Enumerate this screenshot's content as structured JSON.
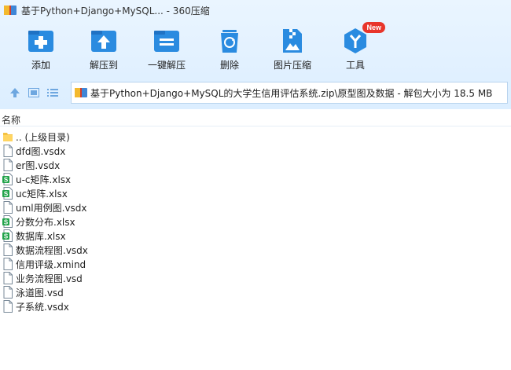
{
  "window": {
    "title": "基于Python+Django+MySQL... - 360压缩"
  },
  "toolbar": {
    "items": [
      {
        "label": "添加",
        "icon": "add-icon"
      },
      {
        "label": "解压到",
        "icon": "extract-to-icon"
      },
      {
        "label": "一键解压",
        "icon": "one-click-extract-icon"
      },
      {
        "label": "删除",
        "icon": "delete-icon"
      },
      {
        "label": "图片压缩",
        "icon": "image-compress-icon"
      },
      {
        "label": "工具",
        "icon": "tools-icon",
        "badge": "New"
      }
    ]
  },
  "address": {
    "path": "基于Python+Django+MySQL的大学生信用评估系统.zip\\原型图及数据 - 解包大小为 18.5 MB"
  },
  "list": {
    "column_name": "名称",
    "files": [
      {
        "name": ".. (上级目录)",
        "type": "folder"
      },
      {
        "name": "dfd图.vsdx",
        "type": "doc"
      },
      {
        "name": "er图.vsdx",
        "type": "doc"
      },
      {
        "name": "u-c矩阵.xlsx",
        "type": "sheet"
      },
      {
        "name": "uc矩阵.xlsx",
        "type": "sheet"
      },
      {
        "name": "uml用例图.vsdx",
        "type": "doc"
      },
      {
        "name": "分数分布.xlsx",
        "type": "sheet"
      },
      {
        "name": "数据库.xlsx",
        "type": "sheet"
      },
      {
        "name": "数据流程图.vsdx",
        "type": "doc"
      },
      {
        "name": "信用评级.xmind",
        "type": "doc"
      },
      {
        "name": "业务流程图.vsd",
        "type": "doc"
      },
      {
        "name": "泳道图.vsd",
        "type": "doc"
      },
      {
        "name": "子系统.vsdx",
        "type": "doc"
      }
    ]
  },
  "colors": {
    "accent_blue": "#2a8be0",
    "sheet_green": "#21a34a",
    "folder_yellow": "#f5c242",
    "badge_red": "#e8352b"
  }
}
